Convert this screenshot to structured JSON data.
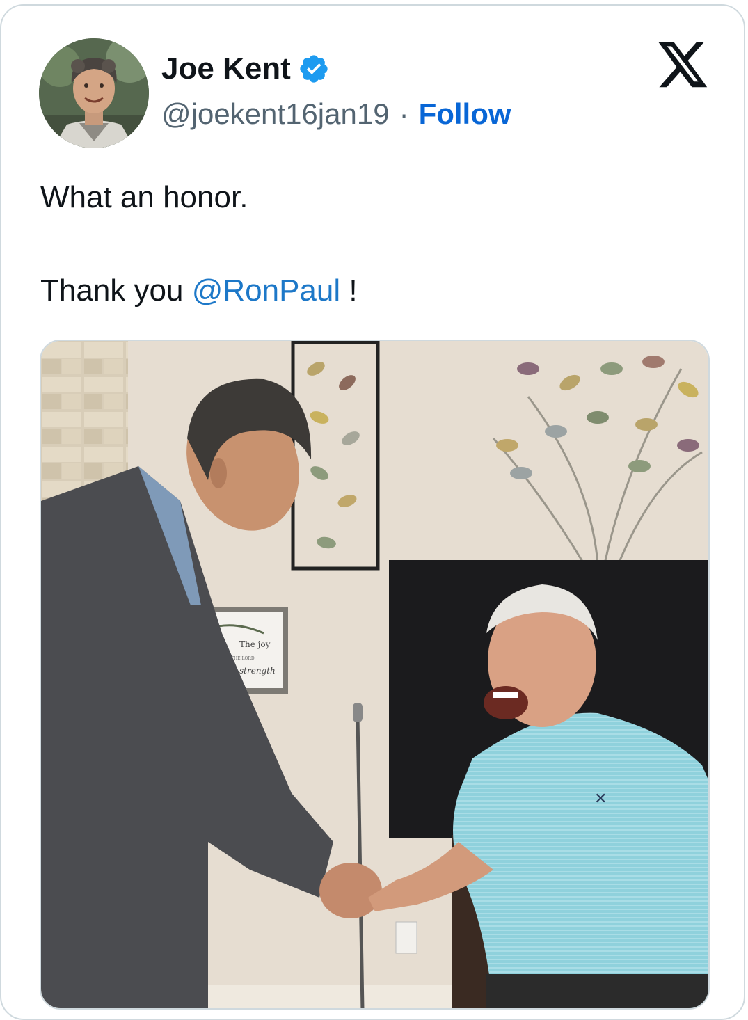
{
  "tweet": {
    "author": {
      "display_name": "Joe Kent",
      "handle": "@joekent16jan19",
      "verified": true,
      "avatar_icon": "profile-photo"
    },
    "separator": "·",
    "follow_label": "Follow",
    "text_line1": "What an honor.",
    "text_line2_prefix": "Thank you ",
    "text_mention": "@RonPaul",
    "text_line2_suffix": " !",
    "platform_icon": "x-logo-icon",
    "media": {
      "kind": "photo",
      "sign_text": "The joy",
      "sign_small": "OF THE LORD",
      "sign_script": "strength"
    }
  },
  "colors": {
    "link": "#0866d6",
    "mention": "#1d78c8",
    "verified_badge": "#1d9bf0",
    "secondary_text": "#536471",
    "border": "#cfd9de"
  }
}
